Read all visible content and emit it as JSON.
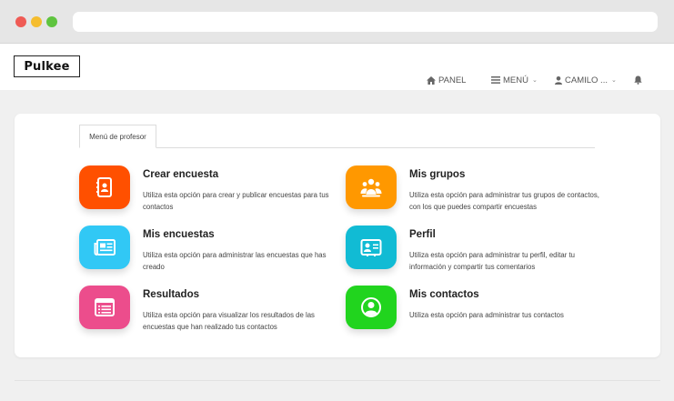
{
  "header": {
    "logo": "Pulkee",
    "nav": {
      "panel": "PANEL",
      "menu": "MENÚ",
      "user": "CAMILO ..."
    }
  },
  "tab": {
    "label": "Menú de profesor"
  },
  "items": [
    {
      "title": "Crear encuesta",
      "description": "Utiliza esta opción para crear y publicar encuestas para tus contactos",
      "color": "#ff5000",
      "icon": "contact-book-icon"
    },
    {
      "title": "Mis grupos",
      "description": "Utiliza esta opción para administrar tus grupos de contactos, con los que puedes compartir encuestas",
      "color": "#ff9800",
      "icon": "users-group-icon"
    },
    {
      "title": "Mis encuestas",
      "description": "Utiliza esta opción para administrar las encuestas que has creado",
      "color": "#31c8f5",
      "icon": "newspaper-icon"
    },
    {
      "title": "Perfil",
      "description": "Utiliza esta opción para administrar tu perfil, editar tu información y compartir tus comentarios",
      "color": "#11bbd4",
      "icon": "id-card-icon"
    },
    {
      "title": "Resultados",
      "description": "Utiliza esta opción para visualizar los resultados de las encuestas que han realizado tus contactos",
      "color": "#ec4d8c",
      "icon": "list-window-icon"
    },
    {
      "title": "Mis contactos",
      "description": "Utiliza esta opción para administrar tus contactos",
      "color": "#21d41e",
      "icon": "user-circle-icon"
    }
  ]
}
